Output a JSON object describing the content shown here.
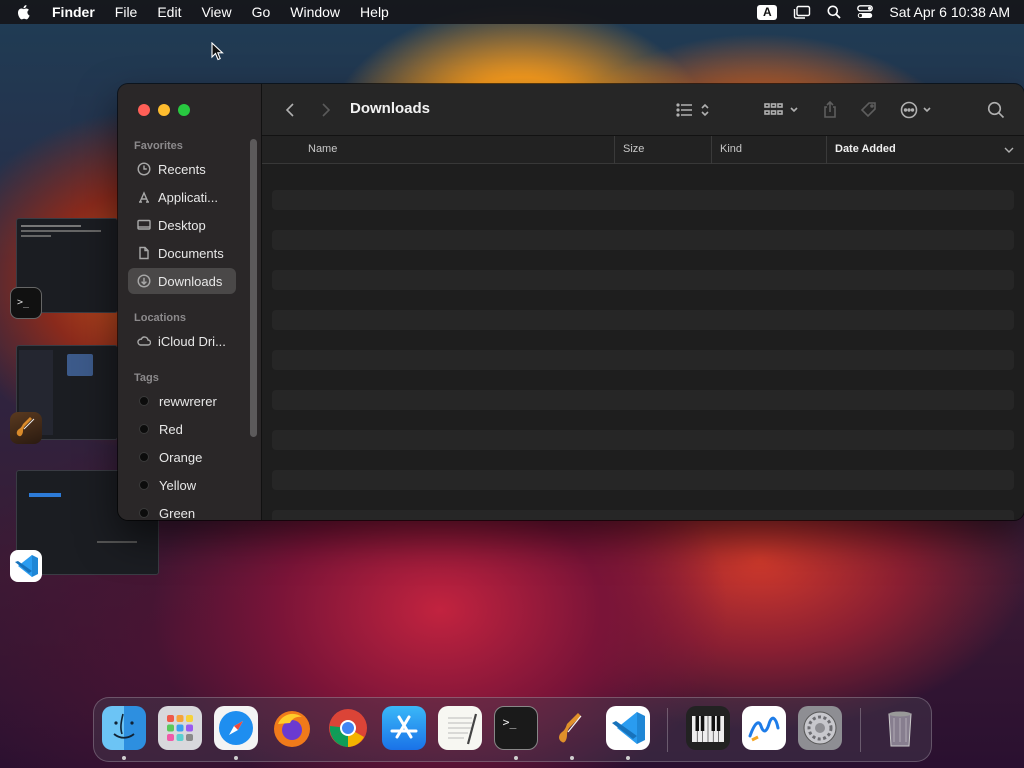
{
  "menubar": {
    "app_name": "Finder",
    "items": [
      "File",
      "Edit",
      "View",
      "Go",
      "Window",
      "Help"
    ],
    "input_source": "A",
    "clock": "Sat Apr 6  10:38 AM"
  },
  "finder": {
    "title": "Downloads",
    "sidebar": {
      "favorites_header": "Favorites",
      "favorites": [
        {
          "label": "Recents",
          "icon": "clock-icon"
        },
        {
          "label": "Applicati...",
          "icon": "applications-icon"
        },
        {
          "label": "Desktop",
          "icon": "desktop-icon"
        },
        {
          "label": "Documents",
          "icon": "document-icon"
        },
        {
          "label": "Downloads",
          "icon": "download-icon",
          "active": true
        }
      ],
      "locations_header": "Locations",
      "locations": [
        {
          "label": "iCloud Dri...",
          "icon": "cloud-icon"
        }
      ],
      "tags_header": "Tags",
      "tags": [
        {
          "label": "rewwrerer"
        },
        {
          "label": "Red"
        },
        {
          "label": "Orange"
        },
        {
          "label": "Yellow"
        },
        {
          "label": "Green"
        }
      ]
    },
    "columns": {
      "name": "Name",
      "size": "Size",
      "kind": "Kind",
      "date_added": "Date Added"
    }
  },
  "dock": {
    "apps": [
      "Finder",
      "Launchpad",
      "Safari",
      "Firefox",
      "Chrome",
      "App Store",
      "TextEdit",
      "Terminal",
      "GarageBand",
      "Visual Studio Code",
      "Piano",
      "Freeform",
      "System Settings",
      "Trash"
    ]
  },
  "colors": {
    "accent_red": "#ff5f57",
    "accent_yellow": "#febc2e",
    "accent_green": "#28c840",
    "sidebar_bg": "#2a2728",
    "window_bg": "#1e1e1e"
  }
}
